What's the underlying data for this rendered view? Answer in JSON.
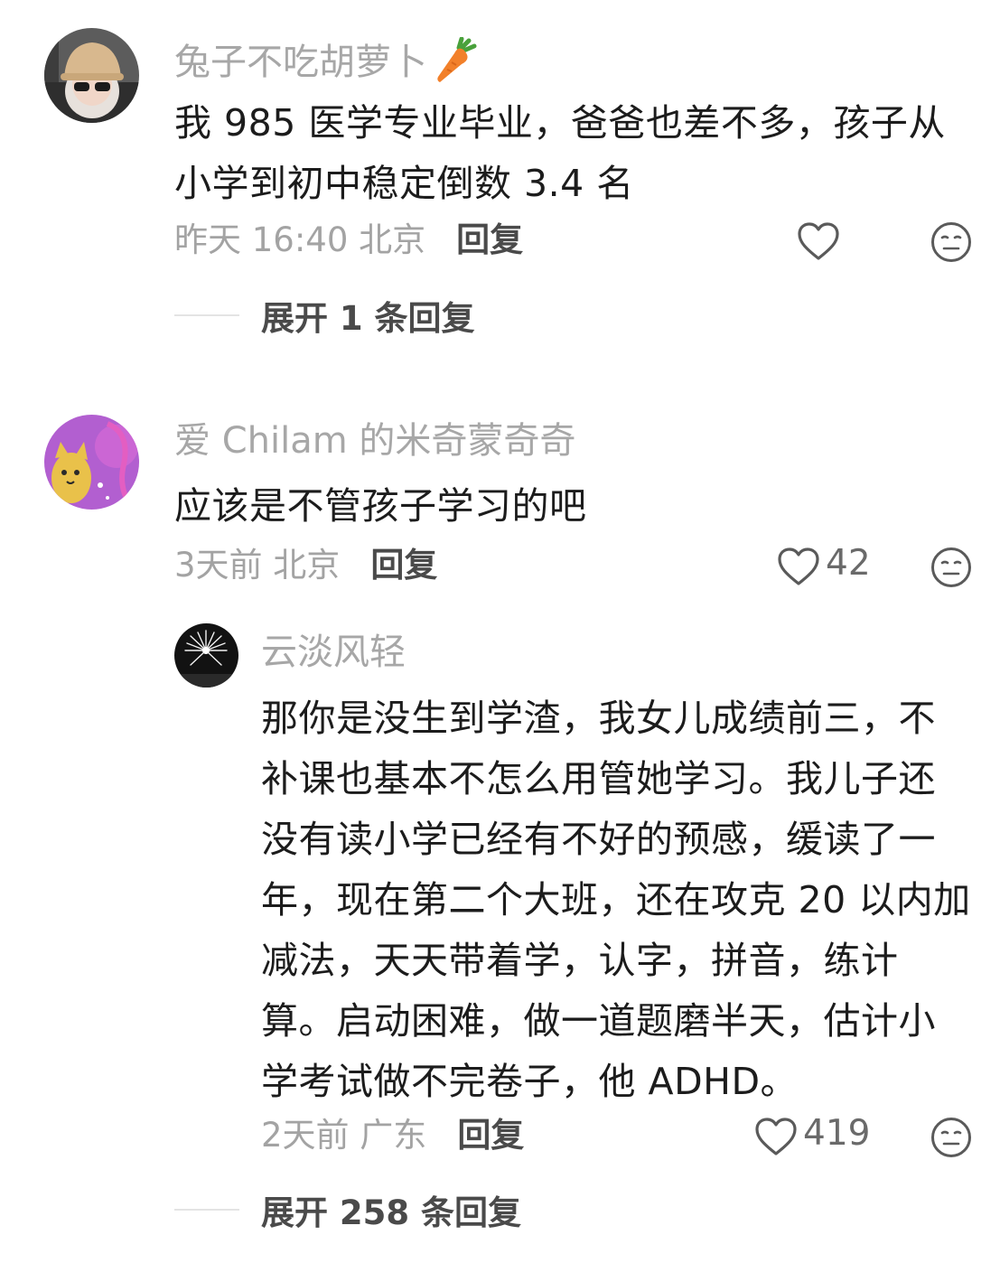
{
  "comments": [
    {
      "username": "兔子不吃胡萝卜",
      "username_emoji": "carrot-emoji",
      "content": "我985医学专业毕业，爸爸也差不多，孩子从小学到初中稳定倒数3.4名",
      "content_lines": [
        "我 985 医学专业毕业，爸爸也差不多，孩子从",
        "小学到初中稳定倒数 3.4 名"
      ],
      "time_location": "昨天 16:40 北京",
      "reply_label": "回复",
      "like_count": "",
      "expand_label": "展开 1 条回复"
    },
    {
      "username": "爱 Chilam 的米奇蒙奇奇",
      "content": "应该是不管孩子学习的吧",
      "content_lines": [
        "应该是不管孩子学习的吧"
      ],
      "time_location": "3天前 北京",
      "reply_label": "回复",
      "like_count": "42",
      "reply": {
        "username": "云淡风轻",
        "content_lines": [
          "那你是没生到学渣，我女儿成绩前三，不",
          "补课也基本不怎么用管她学习。我儿子还",
          "没有读小学已经有不好的预感，缓读了一",
          "年，现在第二个大班，还在攻克 20 以内加",
          "减法，天天带着学，认字，拼音，练计",
          "算。启动困难，做一道题磨半天，估计小",
          "学考试做不完卷子，他 ADHD。"
        ],
        "time_location": "2天前 广东",
        "reply_label": "回复",
        "like_count": "419"
      },
      "expand_label": "展开 258 条回复"
    }
  ],
  "icons": {
    "like": "heart-outline-icon",
    "dislike": "neutral-face-icon"
  },
  "colors": {
    "username": "#a7a7a7",
    "content": "#1c1c1c",
    "meta": "#a3a3a3",
    "reply": "#4a4a4a"
  }
}
